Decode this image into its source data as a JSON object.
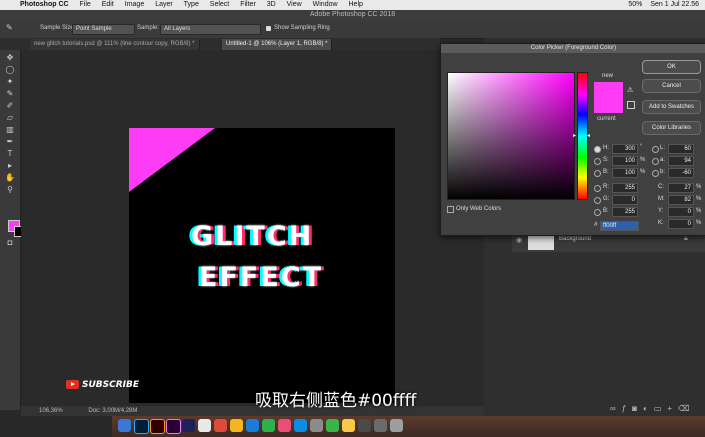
{
  "menubar": {
    "app": "Photoshop CC",
    "items": [
      "File",
      "Edit",
      "Image",
      "Layer",
      "Type",
      "Select",
      "Filter",
      "3D",
      "View",
      "Window",
      "Help"
    ],
    "battery": "50%",
    "clock": "Sen 1 Jul 22.56"
  },
  "app_title": "Adobe Photoshop CC 2018",
  "options": {
    "sample_size_label": "Sample Size:",
    "sample_size_value": "Point Sample",
    "sample_label": "Sample:",
    "sample_value": "All Layers",
    "sampling_ring": "Show Sampling Ring"
  },
  "tabs": [
    {
      "label": "new glitch tutorials.psd @ 111% (line contour copy, RGB/8) *"
    },
    {
      "label": "Untitled-1 @ 106% (Layer 1, RGB/8) *"
    }
  ],
  "canvas": {
    "line1": "GLITCH",
    "line2": "EFFECT",
    "triangle_color": "#ff3cf5"
  },
  "status": {
    "zoom": "106,36%",
    "doc": "Doc: 3,00M/4,28M"
  },
  "color_picker": {
    "title": "Color Picker (Foreground Color)",
    "ok": "OK",
    "cancel": "Cancel",
    "add_swatches": "Add to Swatches",
    "libraries": "Color Libraries",
    "new_label": "new",
    "current_label": "current",
    "only_web": "Only Web Colors",
    "hsb": [
      {
        "label": "H:",
        "value": "300",
        "unit": "°"
      },
      {
        "label": "S:",
        "value": "100",
        "unit": "%"
      },
      {
        "label": "B:",
        "value": "100",
        "unit": "%"
      }
    ],
    "rgb": [
      {
        "label": "R:",
        "value": "255"
      },
      {
        "label": "G:",
        "value": "0"
      },
      {
        "label": "B:",
        "value": "255"
      }
    ],
    "lab": [
      {
        "label": "L:",
        "value": "60"
      },
      {
        "label": "a:",
        "value": "94"
      },
      {
        "label": "b:",
        "value": "-60"
      }
    ],
    "cmyk": [
      {
        "label": "C:",
        "value": "27",
        "unit": "%"
      },
      {
        "label": "M:",
        "value": "82",
        "unit": "%"
      },
      {
        "label": "Y:",
        "value": "0",
        "unit": "%"
      },
      {
        "label": "K:",
        "value": "0",
        "unit": "%"
      }
    ],
    "hex_label": "#",
    "hex": "ff00ff",
    "color": "#ff3cf5"
  },
  "layers": {
    "background": "Background"
  },
  "overlay": {
    "subscribe": "SUBSCRIBE",
    "subtitle": "吸取右侧蓝色#00ffff"
  }
}
